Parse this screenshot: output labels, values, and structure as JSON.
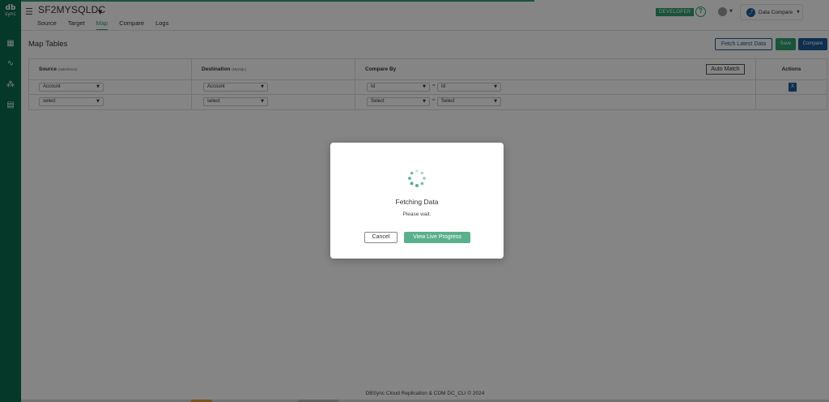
{
  "sidebar": {
    "logo": {
      "main": "db",
      "sub": "sync"
    },
    "items": [
      {
        "name": "grid-icon",
        "glyph": "▦"
      },
      {
        "name": "activity-icon",
        "glyph": "∿"
      },
      {
        "name": "users-icon",
        "glyph": "⁂"
      },
      {
        "name": "document-icon",
        "glyph": "▤"
      }
    ]
  },
  "header": {
    "title": "SF2MYSQLDC",
    "tabs": [
      {
        "label": "Source",
        "active": false
      },
      {
        "label": "Target",
        "active": false
      },
      {
        "label": "Map",
        "active": true
      },
      {
        "label": "Compare",
        "active": false
      },
      {
        "label": "Logs",
        "active": false
      }
    ],
    "badge": "DEVELOPER",
    "help": "?",
    "product": {
      "icon": "⤴",
      "label": "Data Compare"
    }
  },
  "main": {
    "title": "Map Tables",
    "buttons": {
      "fetch": "Fetch Latest Data",
      "save": "Save",
      "compare": "Compare"
    },
    "table": {
      "headers": {
        "source": "Source",
        "source_hint": "(salesforce)",
        "destination": "Destination",
        "destination_hint": "(MySQL)",
        "compare_by": "Compare By",
        "actions": "Actions"
      },
      "auto_match": "Auto Match",
      "rows": [
        {
          "source": "Account",
          "destination": "Account",
          "compare_left": "Id",
          "compare_right": "Id",
          "action": "X"
        },
        {
          "source": "select",
          "destination": "select",
          "compare_left": "Select",
          "compare_right": "Select",
          "action": ""
        }
      ],
      "eq": "="
    }
  },
  "footer": "DBSync Cloud Replication & CDM DC_CLI © 2024",
  "modal": {
    "title": "Fetching Data",
    "subtitle": "Please wait.",
    "cancel": "Cancel",
    "live": "View Live Progress"
  },
  "colors": {
    "brand_green": "#2e9f72",
    "sidebar": "#0b6b4f",
    "brand_blue": "#1c5b9a"
  }
}
